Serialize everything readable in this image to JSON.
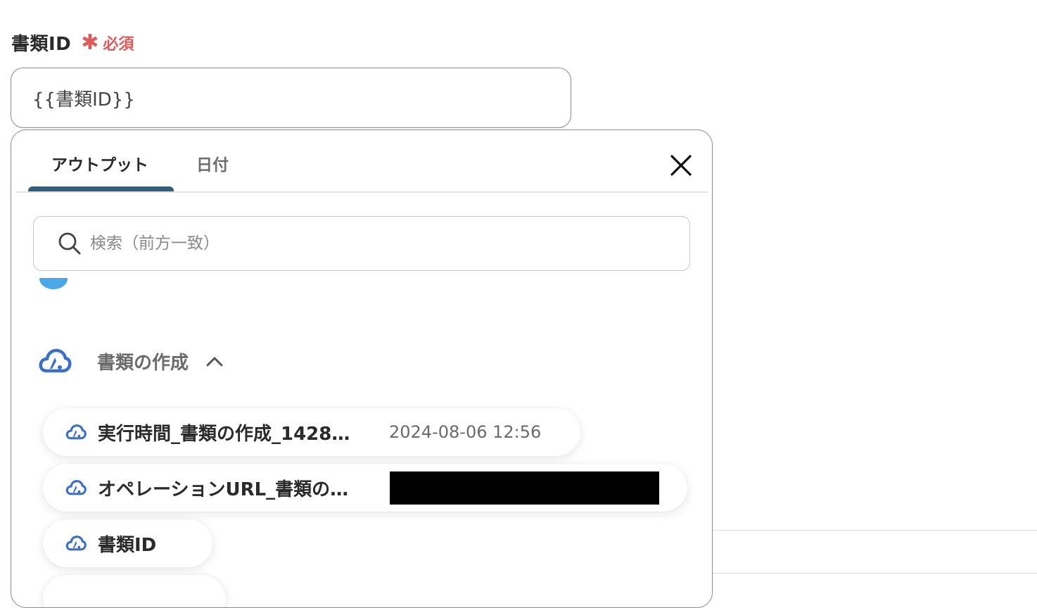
{
  "field": {
    "label": "書類ID",
    "required_mark": "✱",
    "required_text": "必須",
    "value": "{{書類ID}}"
  },
  "popup": {
    "tabs": [
      {
        "label": "アウトプット",
        "active": true
      },
      {
        "label": "日付",
        "active": false
      }
    ],
    "search_placeholder": "検索（前方一致）",
    "section": {
      "title": "書類の作成",
      "expanded": true,
      "items": [
        {
          "label": "実行時間_書類の作成_1428…",
          "value": "2024-08-06 12:56"
        },
        {
          "label": "オペレーションURL_書類の…",
          "value_redacted": true
        },
        {
          "label": "書類ID"
        }
      ]
    }
  },
  "colors": {
    "accent": "#305f7f",
    "required": "#e05a5a",
    "cloud_icon": "#3a6fc6"
  },
  "icons": [
    "close-icon",
    "search-icon",
    "cloud-icon",
    "chevron-up-icon"
  ]
}
